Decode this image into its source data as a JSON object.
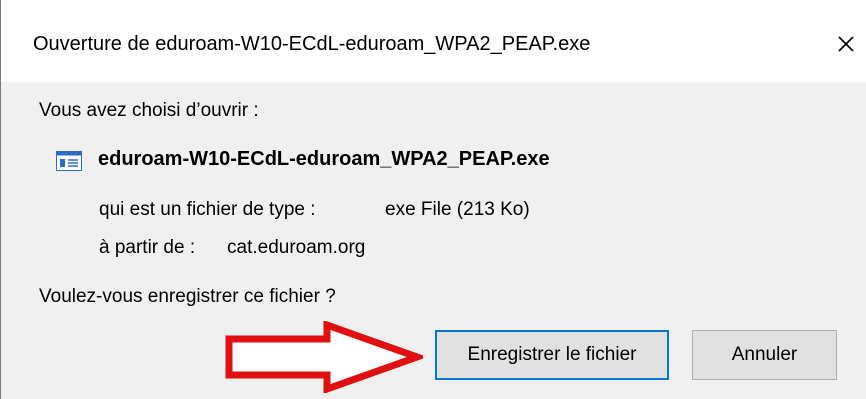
{
  "dialog": {
    "title": "Ouverture de eduroam-W10-ECdL-eduroam_WPA2_PEAP.exe",
    "intro": "Vous avez choisi d’ouvrir :",
    "file": {
      "name": "eduroam-W10-ECdL-eduroam_WPA2_PEAP.exe",
      "type_label": "qui est un fichier de type :",
      "type_value": "exe File (213 Ko)",
      "source_label": "à partir de :",
      "source_value": "cat.eduroam.org"
    },
    "question": "Voulez-vous enregistrer ce fichier ?",
    "buttons": {
      "save": "Enregistrer le fichier",
      "cancel": "Annuler"
    }
  },
  "colors": {
    "arrow": "#e01010",
    "focus_border": "#0078d7"
  }
}
